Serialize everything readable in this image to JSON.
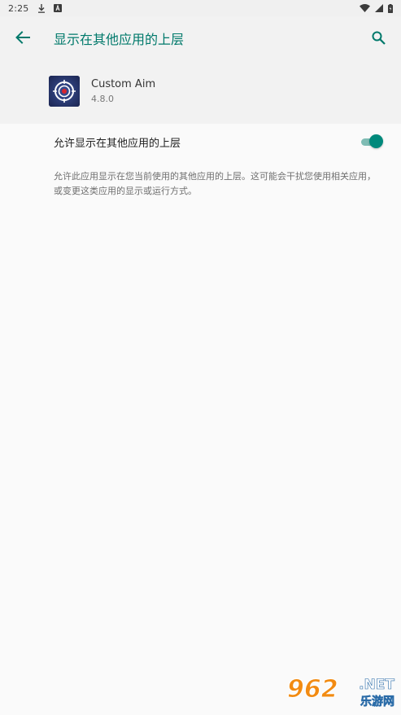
{
  "status_bar": {
    "time": "2:25",
    "icons": [
      "download-icon",
      "a-badge-icon",
      "wifi-icon",
      "signal-icon",
      "battery-icon"
    ]
  },
  "app_bar": {
    "title": "显示在其他应用的上层",
    "back_icon": "arrow-back-icon",
    "search_icon": "search-icon",
    "accent_color": "#00796b"
  },
  "app_info": {
    "name": "Custom Aim",
    "version": "4.8.0",
    "icon": "custom-aim-app-icon"
  },
  "setting": {
    "label": "允许显示在其他应用的上层",
    "enabled": true,
    "description": "允许此应用显示在您当前使用的其他应用的上层。这可能会干扰您使用相关应用，或变更这类应用的显示或运行方式。"
  },
  "colors": {
    "accent": "#00897b",
    "toggle_track": "#7fbcb4",
    "header_bg": "#f2f2f2",
    "page_bg": "#fafafa"
  },
  "watermark": {
    "number": "962",
    "domain": ".NET",
    "sub": "乐游网"
  }
}
